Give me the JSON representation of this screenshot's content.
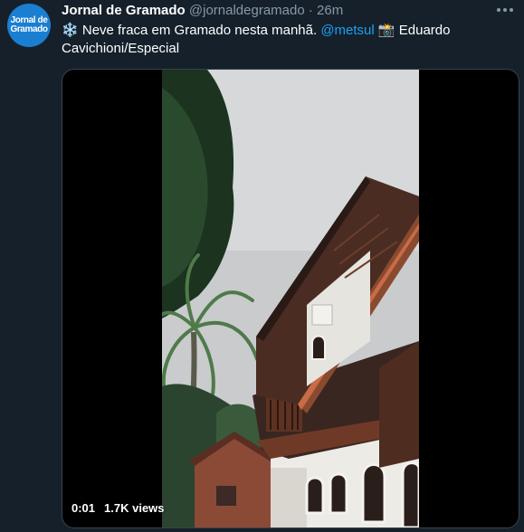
{
  "tweet": {
    "display_name": "Jornal de Gramado",
    "handle": "@jornaldegramado",
    "separator": "·",
    "time": "26m",
    "avatar_line1": "Jornal de",
    "avatar_line2": "Gramado",
    "text_emoji_1": "❄️",
    "text_part_1": " Neve fraca em Gramado nesta manhã. ",
    "mention": "@metsul",
    "text_emoji_2": " 📸 ",
    "text_part_2": "Eduardo Cavichioni/Especial"
  },
  "video": {
    "elapsed": "0:01",
    "views": "1.7K views"
  },
  "colors": {
    "background": "#15202b",
    "accent": "#1da1f2",
    "muted": "#8899a6",
    "avatar": "#1b7fd1"
  },
  "icons": [
    "more-options-icon",
    "snowflake-icon",
    "camera-flash-icon"
  ]
}
